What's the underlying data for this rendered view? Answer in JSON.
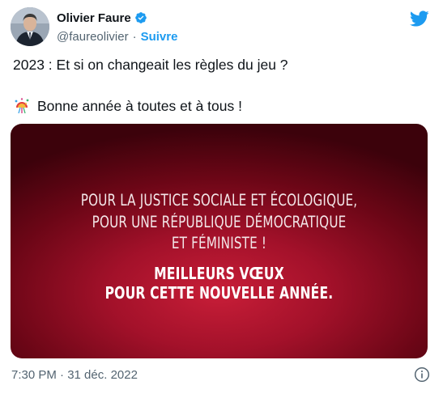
{
  "author": {
    "display_name": "Olivier Faure",
    "handle": "@faureolivier",
    "separator": "·",
    "follow_label": "Suivre"
  },
  "tweet": {
    "line1": "2023 : Et si on changeait les règles du jeu ?",
    "line2": "Bonne année à toutes et à tous !"
  },
  "media": {
    "line1": "POUR LA JUSTICE SOCIALE ET ÉCOLOGIQUE,",
    "line2": "POUR UNE RÉPUBLIQUE DÉMOCRATIQUE",
    "line3": "ET FÉMINISTE !",
    "line4": "MEILLEURS VŒUX",
    "line5": "POUR CETTE NOUVELLE ANNÉE."
  },
  "footer": {
    "timestamp": "7:30 PM · 31 déc. 2022"
  },
  "icons": {
    "verified": "verified-badge-icon",
    "brand": "twitter-bird-icon",
    "emoji": "confetti-ball-icon",
    "info": "info-icon"
  },
  "colors": {
    "brand_blue": "#1d9bf0",
    "text_primary": "#0f1419",
    "text_secondary": "#536471",
    "media_red": "#a3112a"
  }
}
